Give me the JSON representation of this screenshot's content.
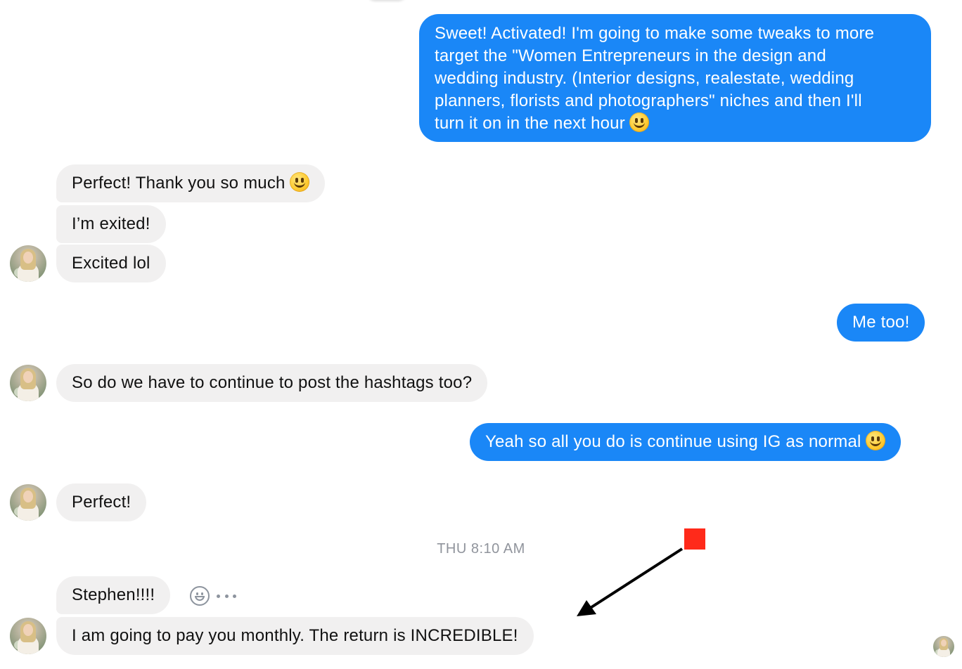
{
  "conversation": {
    "messages": [
      {
        "sender": "me",
        "text": "Sweet! Activated! I'm going to make some tweaks to more",
        "lines": [
          "Sweet! Activated! I'm going to make some tweaks to more",
          "target the \"Women Entrepreneurs in the design and",
          "wedding industry. (Interior designs, realestate, wedding",
          "planners, florists and photographers\" niches and then I'll",
          "turn it on in the next hour"
        ],
        "emoji": "slightly-smiling-face"
      },
      {
        "sender": "them",
        "text": "Perfect! Thank you so much",
        "emoji": "slightly-smiling-face"
      },
      {
        "sender": "them",
        "text": "I’m exited!"
      },
      {
        "sender": "them",
        "text": "Excited lol"
      },
      {
        "sender": "me",
        "text": "Me too!"
      },
      {
        "sender": "them",
        "text": "So do we have to continue to post the hashtags too?"
      },
      {
        "sender": "me",
        "text": "Yeah so all you do is continue using IG as normal",
        "emoji": "slightly-smiling-face"
      },
      {
        "sender": "them",
        "text": "Perfect!"
      },
      {
        "sender": "them",
        "text": "Stephen!!!!"
      },
      {
        "sender": "them",
        "text": "I am going to pay you monthly. The return is INCREDIBLE!"
      }
    ],
    "timestamp": "THU 8:10 AM",
    "colors": {
      "outgoing_bubble": "#1a87f7",
      "incoming_bubble": "#f1f0f0",
      "annotation_marker": "#ff2a1a",
      "annotation_arrow": "#000000"
    },
    "icons": {
      "reaction": "smiley-reaction-icon",
      "more": "more-options-icon"
    }
  }
}
